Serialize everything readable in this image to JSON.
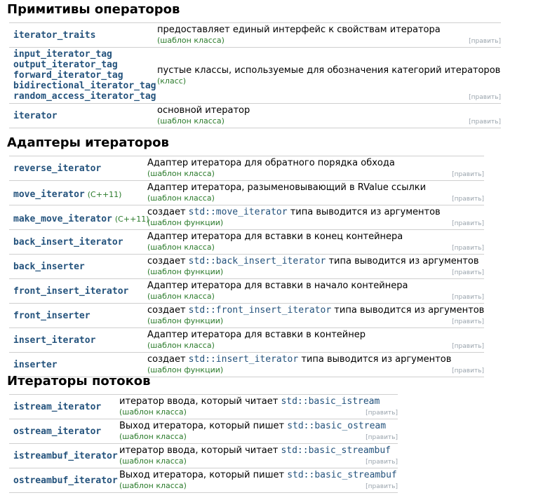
{
  "sections": [
    {
      "title": "Примитивы операторов",
      "rows": [
        {
          "names": [
            "iterator_traits"
          ],
          "mark": "",
          "desc": [
            {
              "t": "предоставляет единый интерфейс к свойствам итератора"
            }
          ],
          "kind": "(шаблон класса)",
          "edit": "[править]"
        },
        {
          "names": [
            "input_iterator_tag",
            "output_iterator_tag",
            "forward_iterator_tag",
            "bidirectional_iterator_tag",
            "random_access_iterator_tag"
          ],
          "mark": "",
          "desc": [
            {
              "t": "пустые классы, используемые для обозначения категорий итераторов"
            }
          ],
          "kind": "(класс)",
          "edit": "[править]"
        },
        {
          "names": [
            "iterator"
          ],
          "mark": "",
          "desc": [
            {
              "t": "основной итератор"
            }
          ],
          "kind": "(шаблон класса)",
          "edit": "[править]"
        }
      ]
    },
    {
      "title": "Адаптеры итераторов",
      "rows": [
        {
          "names": [
            "reverse_iterator"
          ],
          "mark": "",
          "desc": [
            {
              "t": "Адаптер итератора для обратного порядка обхода"
            }
          ],
          "kind": "(шаблон класса)",
          "edit": "[править]"
        },
        {
          "names": [
            "move_iterator"
          ],
          "mark": "(C++11)",
          "desc": [
            {
              "t": "Адаптер итератора, разыменовывающий в RValue ссылки"
            }
          ],
          "kind": "(шаблон класса)",
          "edit": "[править]"
        },
        {
          "names": [
            "make_move_iterator"
          ],
          "mark": "(C++11)",
          "desc": [
            {
              "t": "создает "
            },
            {
              "c": "std::move_iterator"
            },
            {
              "t": " типа выводится из аргументов"
            }
          ],
          "kind": "(шаблон функции)",
          "edit": "[править]"
        },
        {
          "names": [
            "back_insert_iterator"
          ],
          "mark": "",
          "desc": [
            {
              "t": "Адаптер итератора для вставки в конец контейнера"
            }
          ],
          "kind": "(шаблон класса)",
          "edit": "[править]"
        },
        {
          "names": [
            "back_inserter"
          ],
          "mark": "",
          "desc": [
            {
              "t": "создает "
            },
            {
              "c": "std::back_insert_iterator"
            },
            {
              "t": " типа выводится из аргументов"
            }
          ],
          "kind": "(шаблон функции)",
          "edit": "[править]"
        },
        {
          "names": [
            "front_insert_iterator"
          ],
          "mark": "",
          "desc": [
            {
              "t": "Адаптер итератора для вставки в начало контейнера"
            }
          ],
          "kind": "(шаблон класса)",
          "edit": "[править]"
        },
        {
          "names": [
            "front_inserter"
          ],
          "mark": "",
          "desc": [
            {
              "t": "создает "
            },
            {
              "c": "std::front_insert_iterator"
            },
            {
              "t": " типа выводится из аргументов"
            }
          ],
          "kind": "(шаблон функции)",
          "edit": "[править]"
        },
        {
          "names": [
            "insert_iterator"
          ],
          "mark": "",
          "desc": [
            {
              "t": "Адаптер итератора для вставки в контейнер"
            }
          ],
          "kind": "(шаблон класса)",
          "edit": "[править]"
        },
        {
          "names": [
            "inserter"
          ],
          "mark": "",
          "desc": [
            {
              "t": "создает "
            },
            {
              "c": "std::insert_iterator"
            },
            {
              "t": " типа выводится из аргументов"
            }
          ],
          "kind": "(шаблон функции)",
          "edit": "[править]"
        }
      ]
    },
    {
      "title": "Итераторы потоков",
      "rows": [
        {
          "names": [
            "istream_iterator"
          ],
          "mark": "",
          "desc": [
            {
              "t": "итератор ввода, который читает "
            },
            {
              "c": "std::basic_istream"
            }
          ],
          "kind": "(шаблон класса)",
          "edit": "[править]"
        },
        {
          "names": [
            "ostream_iterator"
          ],
          "mark": "",
          "desc": [
            {
              "t": "Выход итератора, который пишет "
            },
            {
              "c": "std::basic_ostream"
            }
          ],
          "kind": "(шаблон класса)",
          "edit": "[править]"
        },
        {
          "names": [
            "istreambuf_iterator"
          ],
          "mark": "",
          "desc": [
            {
              "t": "итератор ввода, который читает "
            },
            {
              "c": "std::basic_streambuf"
            }
          ],
          "kind": "(шаблон класса)",
          "edit": "[править]"
        },
        {
          "names": [
            "ostreambuf_iterator"
          ],
          "mark": "",
          "desc": [
            {
              "t": "Выход итератора, который пишет "
            },
            {
              "c": "std::basic_streambuf"
            }
          ],
          "kind": "(шаблон класса)",
          "edit": "[править]"
        }
      ]
    }
  ],
  "colors": {
    "link": "#23527c",
    "kind": "#2a7a2a",
    "edit": "#9aa4ad",
    "border": "#cfcfcf"
  }
}
